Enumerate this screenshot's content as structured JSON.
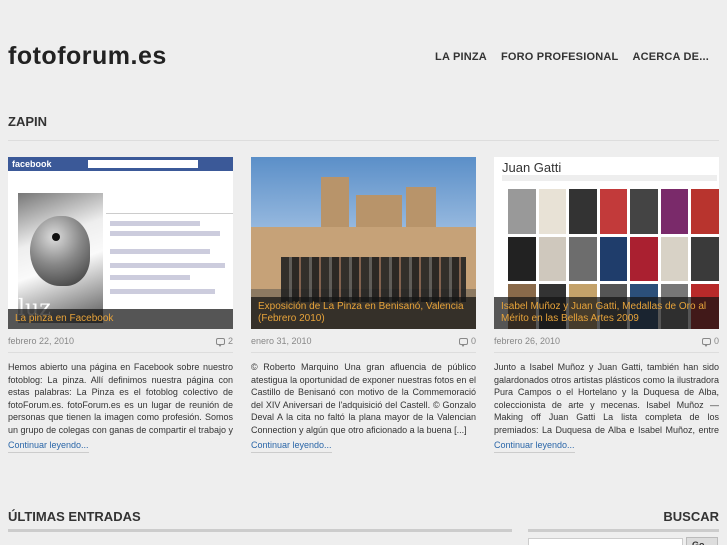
{
  "site": {
    "logo": "fotoforum.es"
  },
  "nav": [
    "LA PINZA",
    "FORO PROFESIONAL",
    "ACERCA DE..."
  ],
  "section": {
    "title": "ZAPIN"
  },
  "posts": [
    {
      "caption": "La pinza en Facebook",
      "date": "febrero 22, 2010",
      "comments": "2",
      "excerpt": "Hemos abierto una página en Facebook sobre nuestro fotoblog: La pinza. Allí definimos nuestra página con estas palabras: La Pinza es el fotoblog colectivo de fotoForum.es. fotoForum.es es un lugar de reunión de personas que tienen la imagen como profesión. Somos un grupo de colegas con ganas de compartir el trabajo y la ilusión de [...]",
      "more": "Continuar leyendo..."
    },
    {
      "caption": "Exposición de La Pinza en Benisanó, Valencia (Febrero 2010)",
      "date": "enero 31, 2010",
      "comments": "0",
      "excerpt": "© Roberto Marquino Una gran afluencia de público atestigua la oportunidad de exponer nuestras fotos en el Castillo de Benisanó con motivo de la Commemoració del XIV Aniversari de l'adquisició del Castell. © Gonzalo Deval A la cita no faltó la plana mayor de la Valencian Connection y algún que otro aficionado a la buena [...]",
      "more": "Continuar leyendo..."
    },
    {
      "caption": "Isabel Muñoz y Juan Gatti, Medallas de Oro al Mérito en las Bellas Artes 2009",
      "date": "febrero 26, 2010",
      "comments": "0",
      "excerpt": "Junto a Isabel Muñoz y Juan Gatti, también han sido galardonados otros artistas plásticos como la ilustradora Pura Campos o el Hortelano y la Duquesa de Alba, coleccionista de arte y mecenas. Isabel Muñoz — Making off Juan Gatti La lista completa de los premiados: La Duquesa de Alba e Isabel Muñoz, entre las Medallas [...]",
      "more": "Continuar leyendo..."
    }
  ],
  "thumb_text": {
    "fb_logo": "facebook",
    "fb_luz": "luz",
    "jg_title": "Juan Gatti"
  },
  "bottom": {
    "latest": "ÚLTIMAS ENTRADAS",
    "search": "BUSCAR",
    "search_button": "Go"
  }
}
